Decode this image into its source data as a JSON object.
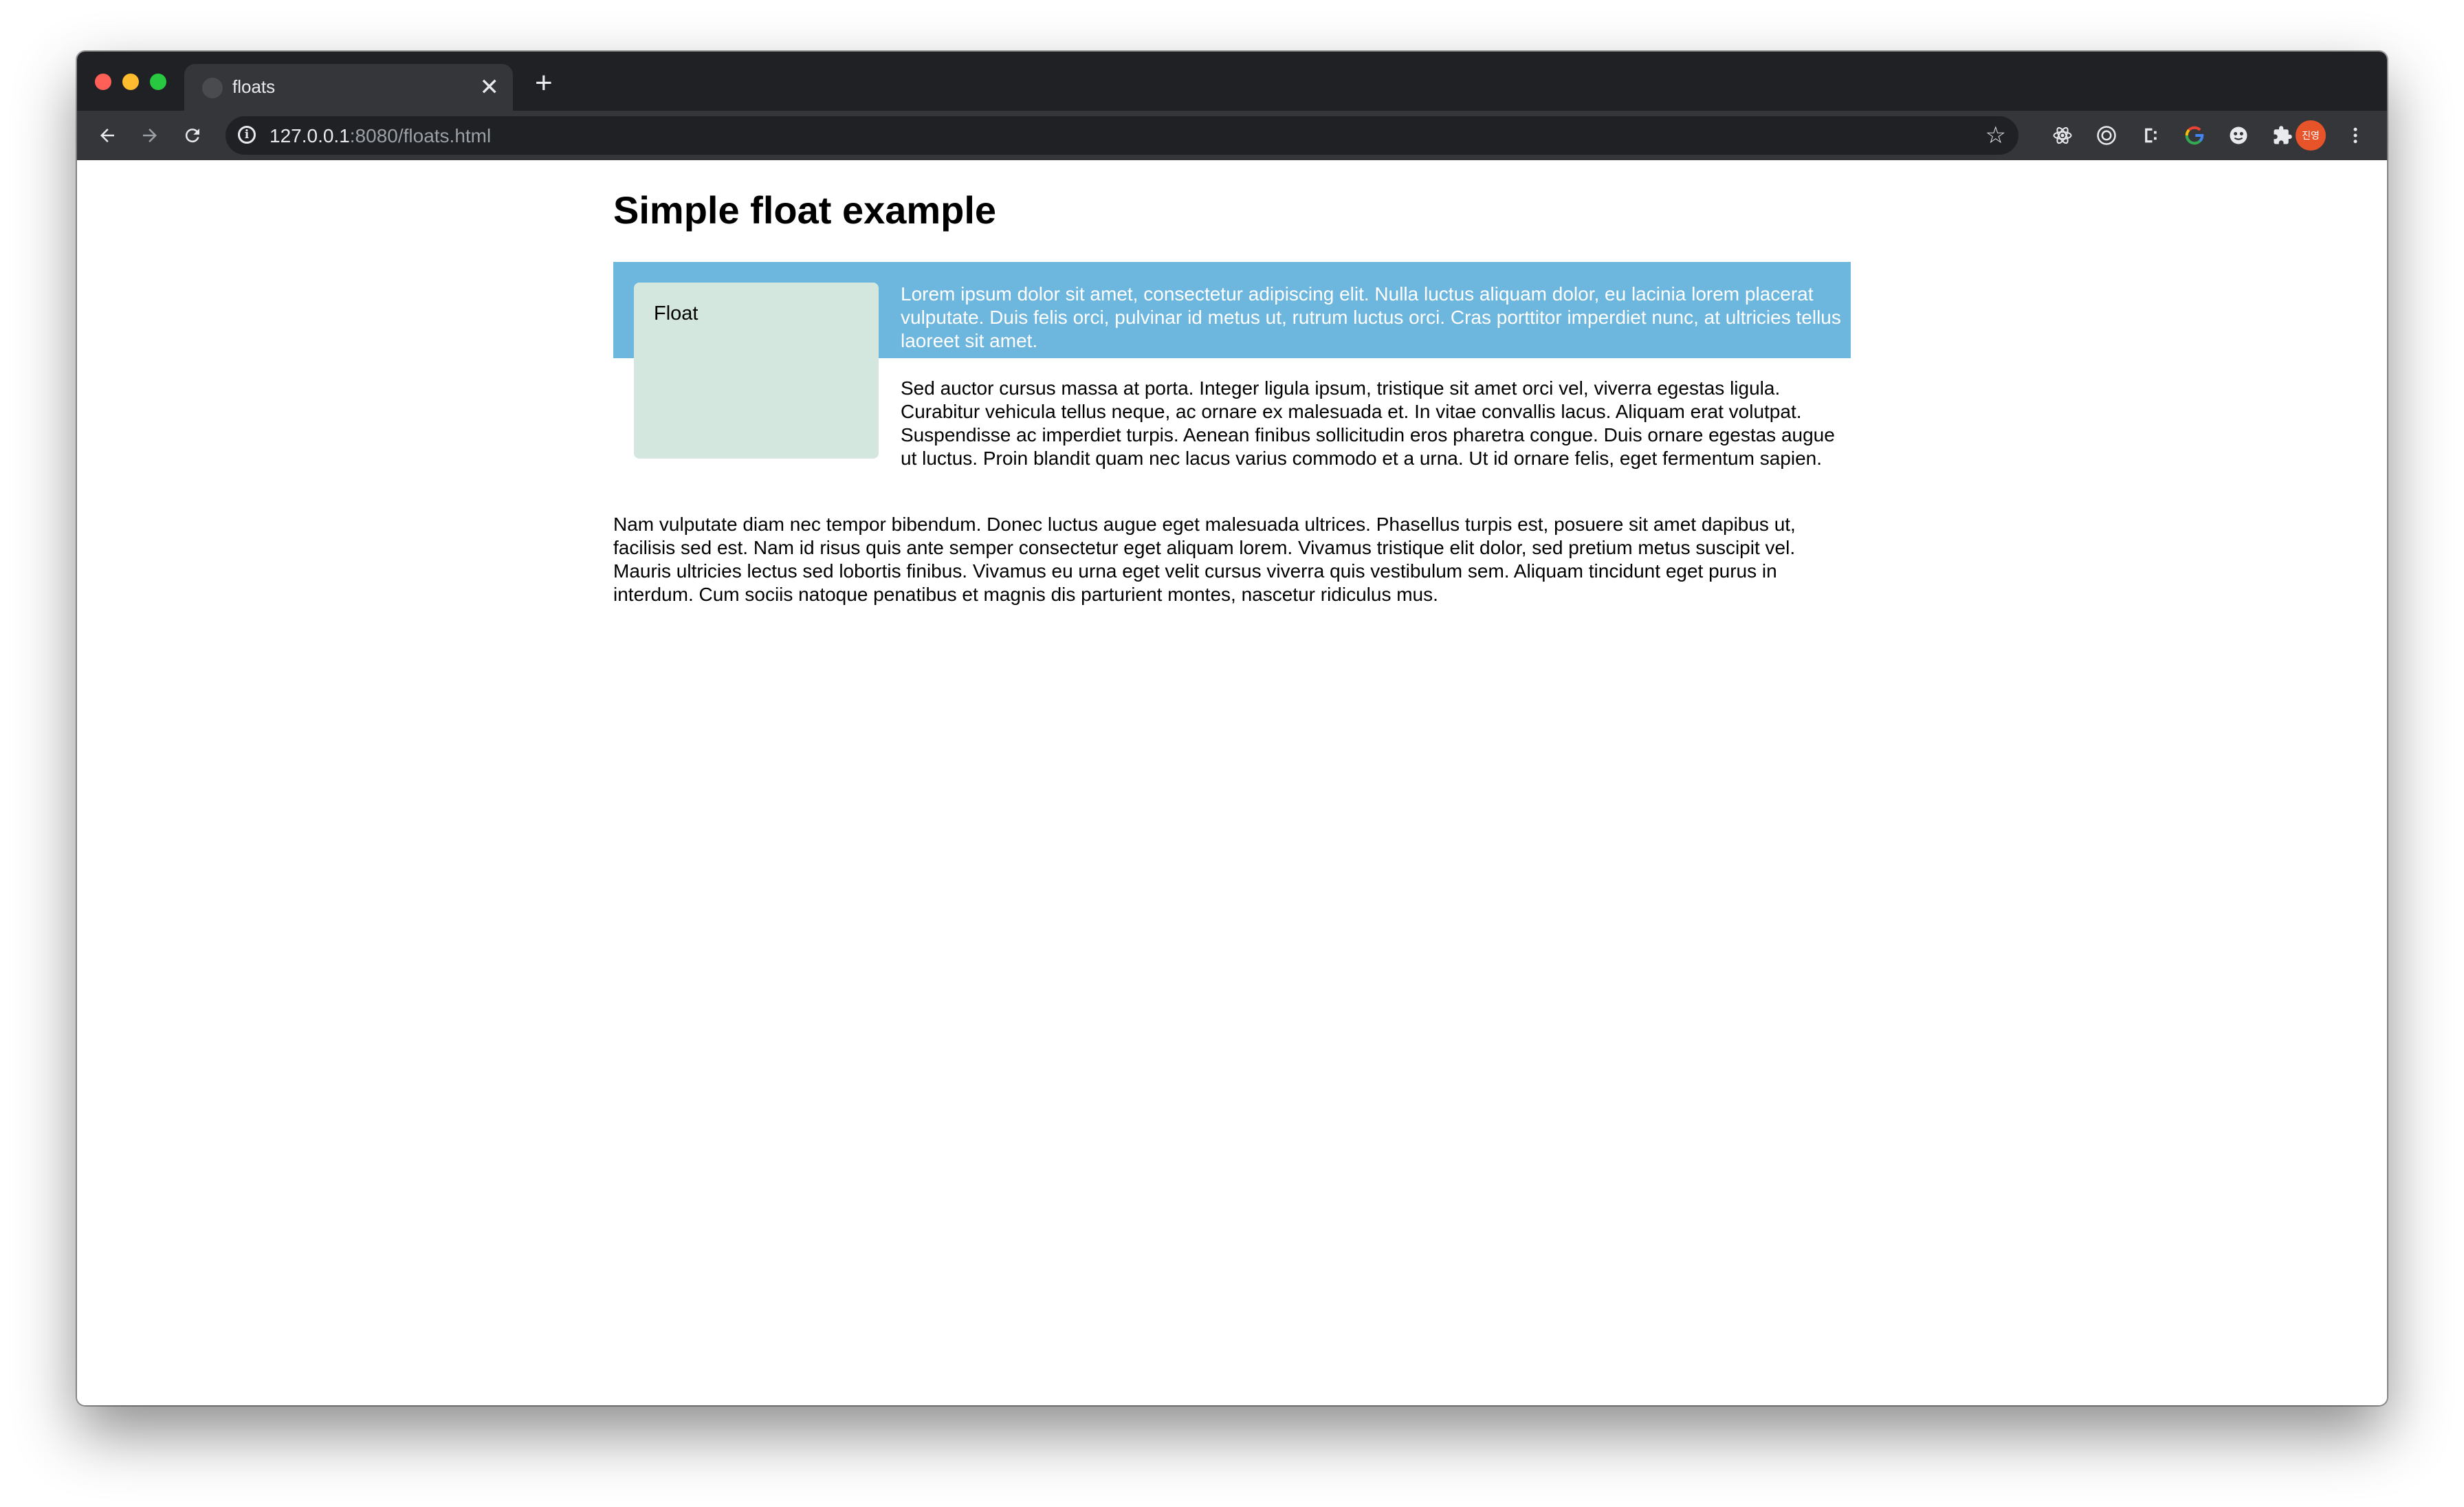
{
  "browser": {
    "tab": {
      "title": "floats",
      "close_glyph": "✕"
    },
    "new_tab_glyph": "+",
    "address": {
      "host": "127.0.0.1",
      "rest": ":8080/floats.html"
    },
    "avatar_text": "진영",
    "extensions": [
      "react-icon",
      "target-icon",
      "css-icon",
      "google-icon",
      "face-icon",
      "puzzle-icon"
    ]
  },
  "page": {
    "heading": "Simple float example",
    "float_label": "Float",
    "paragraph1": "Lorem ipsum dolor sit amet, consectetur adipiscing elit. Nulla luctus aliquam dolor, eu lacinia lorem placerat vulputate. Duis felis orci, pulvinar id metus ut, rutrum luctus orci. Cras porttitor imperdiet nunc, at ultricies tellus laoreet sit amet.",
    "paragraph2": "Sed auctor cursus massa at porta. Integer ligula ipsum, tristique sit amet orci vel, viverra egestas ligula. Curabitur vehicula tellus neque, ac ornare ex malesuada et. In vitae convallis lacus. Aliquam erat volutpat. Suspendisse ac imperdiet turpis. Aenean finibus sollicitudin eros pharetra congue. Duis ornare egestas augue ut luctus. Proin blandit quam nec lacus varius commodo et a urna. Ut id ornare felis, eget fermentum sapien.",
    "paragraph3": "Nam vulputate diam nec tempor bibendum. Donec luctus augue eget malesuada ultrices. Phasellus turpis est, posuere sit amet dapibus ut, facilisis sed est. Nam id risus quis ante semper consectetur eget aliquam lorem. Vivamus tristique elit dolor, sed pretium metus suscipit vel. Mauris ultricies lectus sed lobortis finibus. Vivamus eu urna eget velit cursus viverra quis vestibulum sem. Aliquam tincidunt eget purus in interdum. Cum sociis natoque penatibus et magnis dis parturient montes, nascetur ridiculus mus."
  },
  "colors": {
    "box_background": "#6db6dd",
    "float_background": "#d3e7de",
    "titlebar": "#202124",
    "toolbar": "#35363a"
  }
}
